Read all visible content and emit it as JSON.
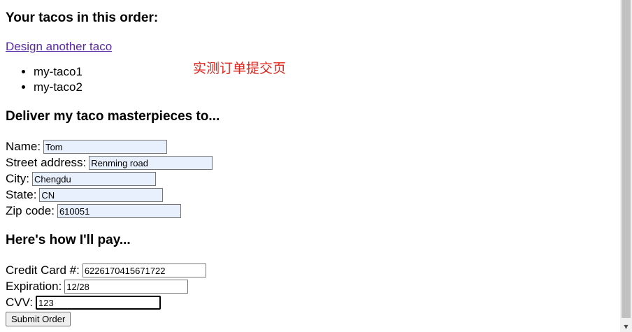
{
  "order": {
    "heading": "Your tacos in this order:",
    "design_link": "Design another taco",
    "tacos": [
      "my-taco1",
      "my-taco2"
    ]
  },
  "annotation": "实测订单提交页",
  "delivery": {
    "heading": "Deliver my taco masterpieces to...",
    "fields": [
      {
        "label": "Name:",
        "value": "Tom"
      },
      {
        "label": "Street address:",
        "value": "Renming road"
      },
      {
        "label": "City:",
        "value": "Chengdu"
      },
      {
        "label": "State:",
        "value": "CN"
      },
      {
        "label": "Zip code:",
        "value": "610051"
      }
    ]
  },
  "payment": {
    "heading": "Here's how I'll pay...",
    "fields": [
      {
        "label": "Credit Card #:",
        "value": "6226170415671722"
      },
      {
        "label": "Expiration:",
        "value": "12/28"
      },
      {
        "label": "CVV:",
        "value": "123"
      }
    ],
    "submit_label": "Submit Order"
  },
  "icons": {
    "scroll_down": "scroll-down-arrow-icon"
  }
}
